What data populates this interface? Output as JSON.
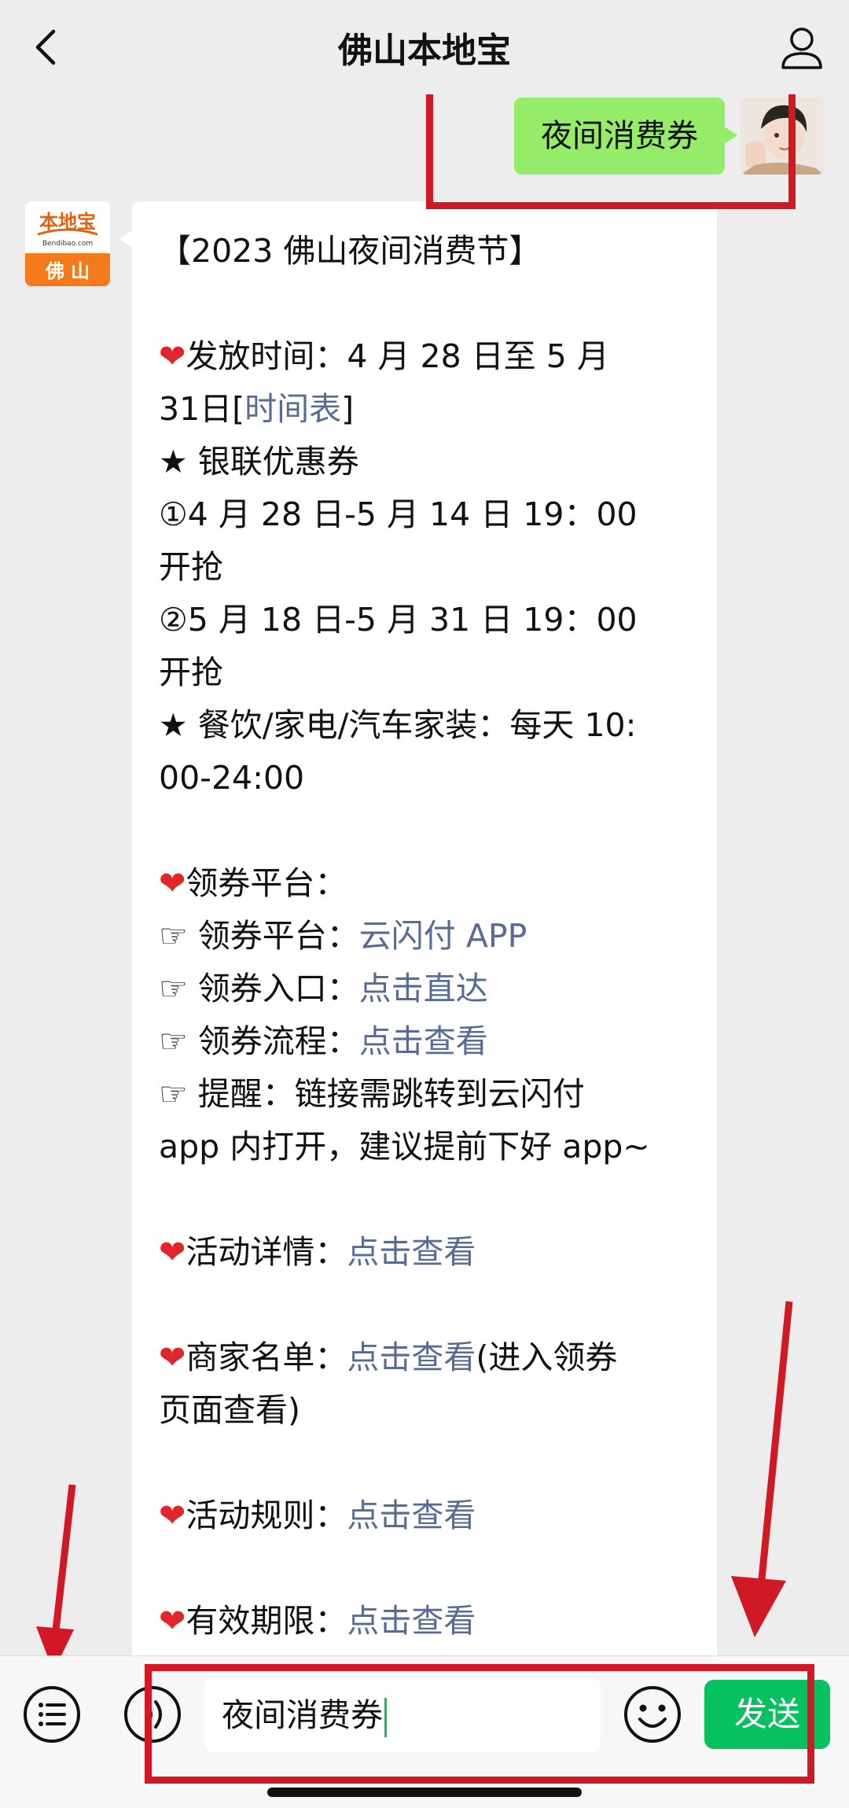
{
  "header": {
    "title": "佛山本地宝",
    "back_icon": "chevron-left-icon",
    "profile_icon": "user-icon"
  },
  "outgoing": {
    "text": "夜间消费券"
  },
  "incoming": {
    "avatar": {
      "brand": "本地宝",
      "domain": "Bendibao.com",
      "city": "佛山",
      "accent": "#f57a1c"
    },
    "lines": [
      {
        "segments": [
          {
            "t": "【2023 佛山夜间消费节】"
          }
        ]
      },
      {
        "blank": true
      },
      {
        "segments": [
          {
            "t": "❤",
            "heart": true
          },
          {
            "t": "发放时间：4 月 28 日至 5 月"
          }
        ]
      },
      {
        "segments": [
          {
            "t": "31日["
          },
          {
            "t": "时间表",
            "link": true
          },
          {
            "t": "]"
          }
        ]
      },
      {
        "segments": [
          {
            "t": "★ 银联优惠券"
          }
        ]
      },
      {
        "segments": [
          {
            "t": "①4 月 28 日-5 月 14 日 19：00"
          }
        ]
      },
      {
        "segments": [
          {
            "t": "开抢"
          }
        ]
      },
      {
        "segments": [
          {
            "t": "②5 月 18 日-5 月 31 日 19：00"
          }
        ]
      },
      {
        "segments": [
          {
            "t": "开抢"
          }
        ]
      },
      {
        "segments": [
          {
            "t": "★ 餐饮/家电/汽车家装：每天 10:"
          }
        ]
      },
      {
        "segments": [
          {
            "t": "00-24:00"
          }
        ]
      },
      {
        "blank": true
      },
      {
        "segments": [
          {
            "t": "❤",
            "heart": true
          },
          {
            "t": "领券平台："
          }
        ]
      },
      {
        "segments": [
          {
            "t": "☞ 领券平台："
          },
          {
            "t": "云闪付 APP",
            "link": true
          }
        ]
      },
      {
        "segments": [
          {
            "t": "☞ 领券入口："
          },
          {
            "t": "点击直达",
            "link": true
          }
        ]
      },
      {
        "segments": [
          {
            "t": "☞ 领券流程："
          },
          {
            "t": "点击查看",
            "link": true
          }
        ]
      },
      {
        "segments": [
          {
            "t": "☞ 提醒：链接需跳转到云闪付"
          }
        ]
      },
      {
        "segments": [
          {
            "t": "app 内打开，建议提前下好 app~"
          }
        ]
      },
      {
        "blank": true
      },
      {
        "segments": [
          {
            "t": "❤",
            "heart": true
          },
          {
            "t": "活动详情："
          },
          {
            "t": "点击查看",
            "link": true
          }
        ]
      },
      {
        "blank": true
      },
      {
        "segments": [
          {
            "t": "❤",
            "heart": true
          },
          {
            "t": "商家名单："
          },
          {
            "t": "点击查看",
            "link": true
          },
          {
            "t": "(进入领券"
          }
        ]
      },
      {
        "segments": [
          {
            "t": "页面查看)"
          }
        ]
      },
      {
        "blank": true
      },
      {
        "segments": [
          {
            "t": "❤",
            "heart": true
          },
          {
            "t": "活动规则："
          },
          {
            "t": "点击查看",
            "link": true
          }
        ]
      },
      {
        "blank": true
      },
      {
        "segments": [
          {
            "t": "❤",
            "heart": true
          },
          {
            "t": "有效期限："
          },
          {
            "t": "点击查看",
            "link": true
          }
        ]
      }
    ]
  },
  "input": {
    "value": "夜间消费券",
    "send_label": "发送",
    "menu_icon": "list-menu-icon",
    "voice_icon": "voice-icon",
    "emoji_icon": "emoji-icon"
  },
  "colors": {
    "accent": "#07c160",
    "bubble_out": "#95ec69",
    "link": "#576b95",
    "annotation": "#d01925"
  }
}
